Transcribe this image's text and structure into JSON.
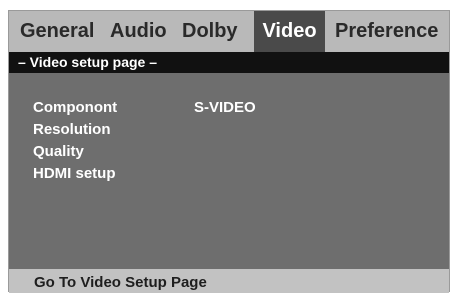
{
  "tabs": [
    {
      "label": "General",
      "active": false
    },
    {
      "label": "Audio",
      "active": false
    },
    {
      "label": "Dolby",
      "active": false
    },
    {
      "label": "Video",
      "active": true
    },
    {
      "label": "Preference",
      "active": false
    }
  ],
  "page_header": "– Video setup page –",
  "menu": {
    "items": [
      {
        "label": "Componont",
        "value": "S-VIDEO"
      },
      {
        "label": "Resolution",
        "value": ""
      },
      {
        "label": "Quality",
        "value": ""
      },
      {
        "label": "HDMI setup",
        "value": ""
      }
    ]
  },
  "status": "Go To Video Setup Page",
  "colors": {
    "panel": "#b9b9b9",
    "content": "#6e6e6e",
    "header_bar": "#111111",
    "active_tab": "#4a4a4a",
    "status_bar": "#c2c2c2"
  }
}
